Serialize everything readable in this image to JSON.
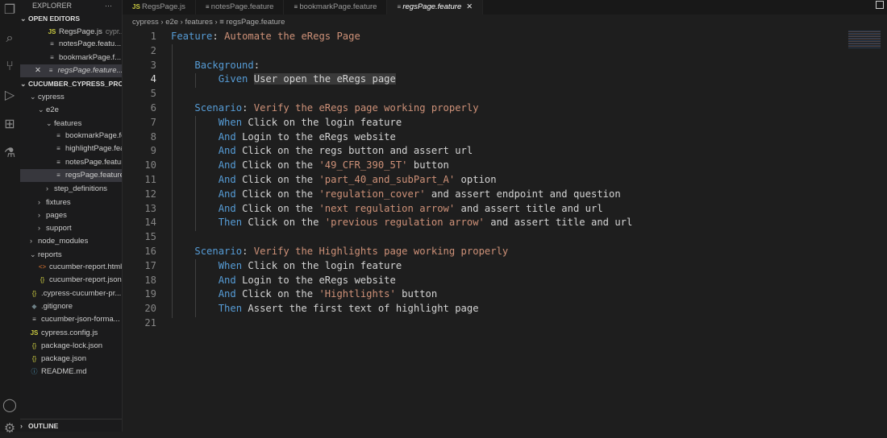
{
  "sidebar": {
    "title": "EXPLORER",
    "more": "···",
    "open_editors_label": "OPEN EDITORS",
    "open_editors": [
      {
        "name": "RegsPage.js",
        "hint": "cypr...",
        "icon": "js"
      },
      {
        "name": "notesPage.featu...",
        "icon": "feat"
      },
      {
        "name": "bookmarkPage.f...",
        "icon": "feat"
      },
      {
        "name": "regsPage.feature...",
        "icon": "feat",
        "active": true
      }
    ],
    "project_label": "CUCUMBER_CYPRESS_PRO...",
    "tree": [
      {
        "name": "cypress",
        "depth": 1,
        "folder": "open"
      },
      {
        "name": "e2e",
        "depth": 2,
        "folder": "open"
      },
      {
        "name": "features",
        "depth": 3,
        "folder": "open"
      },
      {
        "name": "bookmarkPage.fe...",
        "depth": 4,
        "icon": "feat"
      },
      {
        "name": "highlightPage.fea...",
        "depth": 4,
        "icon": "feat"
      },
      {
        "name": "notesPage.feature",
        "depth": 4,
        "icon": "feat"
      },
      {
        "name": "regsPage.feature",
        "depth": 4,
        "icon": "feat",
        "selected": true
      },
      {
        "name": "step_definitions",
        "depth": 3,
        "folder": "closed"
      },
      {
        "name": "fixtures",
        "depth": 2,
        "folder": "closed"
      },
      {
        "name": "pages",
        "depth": 2,
        "folder": "closed"
      },
      {
        "name": "support",
        "depth": 2,
        "folder": "closed"
      },
      {
        "name": "node_modules",
        "depth": 1,
        "folder": "closed"
      },
      {
        "name": "reports",
        "depth": 1,
        "folder": "open"
      },
      {
        "name": "cucumber-report.html",
        "depth": 2,
        "icon": "html"
      },
      {
        "name": "cucumber-report.json",
        "depth": 2,
        "icon": "json"
      },
      {
        "name": ".cypress-cucumber-pr...",
        "depth": 1,
        "icon": "json"
      },
      {
        "name": ".gitignore",
        "depth": 1,
        "icon": "git"
      },
      {
        "name": "cucumber-json-forma...",
        "depth": 1,
        "icon": "feat"
      },
      {
        "name": "cypress.config.js",
        "depth": 1,
        "icon": "js"
      },
      {
        "name": "package-lock.json",
        "depth": 1,
        "icon": "json"
      },
      {
        "name": "package.json",
        "depth": 1,
        "icon": "json"
      },
      {
        "name": "README.md",
        "depth": 1,
        "icon": "md"
      }
    ],
    "outline_label": "OUTLINE"
  },
  "tabs": [
    {
      "name": "RegsPage.js",
      "icon": "js"
    },
    {
      "name": "notesPage.feature",
      "icon": "feat"
    },
    {
      "name": "bookmarkPage.feature",
      "icon": "feat"
    },
    {
      "name": "regsPage.feature",
      "icon": "feat",
      "active": true
    }
  ],
  "breadcrumb": [
    "cypress",
    "e2e",
    "features",
    "regsPage.feature"
  ],
  "editor": {
    "current_line": 4,
    "lines": [
      [
        [
          "k",
          "Feature"
        ],
        [
          "t",
          ": "
        ],
        [
          "s",
          "Automate the eRegs Page"
        ]
      ],
      [],
      [
        [
          "t",
          "    "
        ],
        [
          "k",
          "Background"
        ],
        [
          "t",
          ":"
        ]
      ],
      [
        [
          "t",
          "        "
        ],
        [
          "k",
          "Given "
        ],
        [
          "hl",
          "User open the eRegs page"
        ]
      ],
      [],
      [
        [
          "t",
          "    "
        ],
        [
          "k",
          "Scenario"
        ],
        [
          "t",
          ": "
        ],
        [
          "s",
          "Verify the eRegs page working properly"
        ]
      ],
      [
        [
          "t",
          "        "
        ],
        [
          "k",
          "When "
        ],
        [
          "t",
          "Click on the login feature"
        ]
      ],
      [
        [
          "t",
          "        "
        ],
        [
          "k",
          "And "
        ],
        [
          "t",
          "Login to the eRegs website"
        ]
      ],
      [
        [
          "t",
          "        "
        ],
        [
          "k",
          "And "
        ],
        [
          "t",
          "Click on the regs button and assert url"
        ]
      ],
      [
        [
          "t",
          "        "
        ],
        [
          "k",
          "And "
        ],
        [
          "t",
          "Click on the "
        ],
        [
          "s",
          "'49_CFR_390_5T'"
        ],
        [
          "t",
          " button"
        ]
      ],
      [
        [
          "t",
          "        "
        ],
        [
          "k",
          "And "
        ],
        [
          "t",
          "Click on the "
        ],
        [
          "s",
          "'part_40_and_subPart_A'"
        ],
        [
          "t",
          " option"
        ]
      ],
      [
        [
          "t",
          "        "
        ],
        [
          "k",
          "And "
        ],
        [
          "t",
          "Click on the "
        ],
        [
          "s",
          "'regulation_cover'"
        ],
        [
          "t",
          " and assert endpoint and question"
        ]
      ],
      [
        [
          "t",
          "        "
        ],
        [
          "k",
          "And "
        ],
        [
          "t",
          "Click on the "
        ],
        [
          "s",
          "'next regulation arrow'"
        ],
        [
          "t",
          " and assert title and url"
        ]
      ],
      [
        [
          "t",
          "        "
        ],
        [
          "k",
          "Then "
        ],
        [
          "t",
          "Click on the "
        ],
        [
          "s",
          "'previous regulation arrow'"
        ],
        [
          "t",
          " and assert title and url"
        ]
      ],
      [],
      [
        [
          "t",
          "    "
        ],
        [
          "k",
          "Scenario"
        ],
        [
          "t",
          ": "
        ],
        [
          "s",
          "Verify the Highlights page working properly"
        ]
      ],
      [
        [
          "t",
          "        "
        ],
        [
          "k",
          "When "
        ],
        [
          "t",
          "Click on the login feature"
        ]
      ],
      [
        [
          "t",
          "        "
        ],
        [
          "k",
          "And "
        ],
        [
          "t",
          "Login to the eRegs website"
        ]
      ],
      [
        [
          "t",
          "        "
        ],
        [
          "k",
          "And "
        ],
        [
          "t",
          "Click on the "
        ],
        [
          "s",
          "'Hightlights'"
        ],
        [
          "t",
          " button"
        ]
      ],
      [
        [
          "t",
          "        "
        ],
        [
          "k",
          "Then "
        ],
        [
          "t",
          "Assert the first text of highlight page"
        ]
      ],
      []
    ]
  }
}
